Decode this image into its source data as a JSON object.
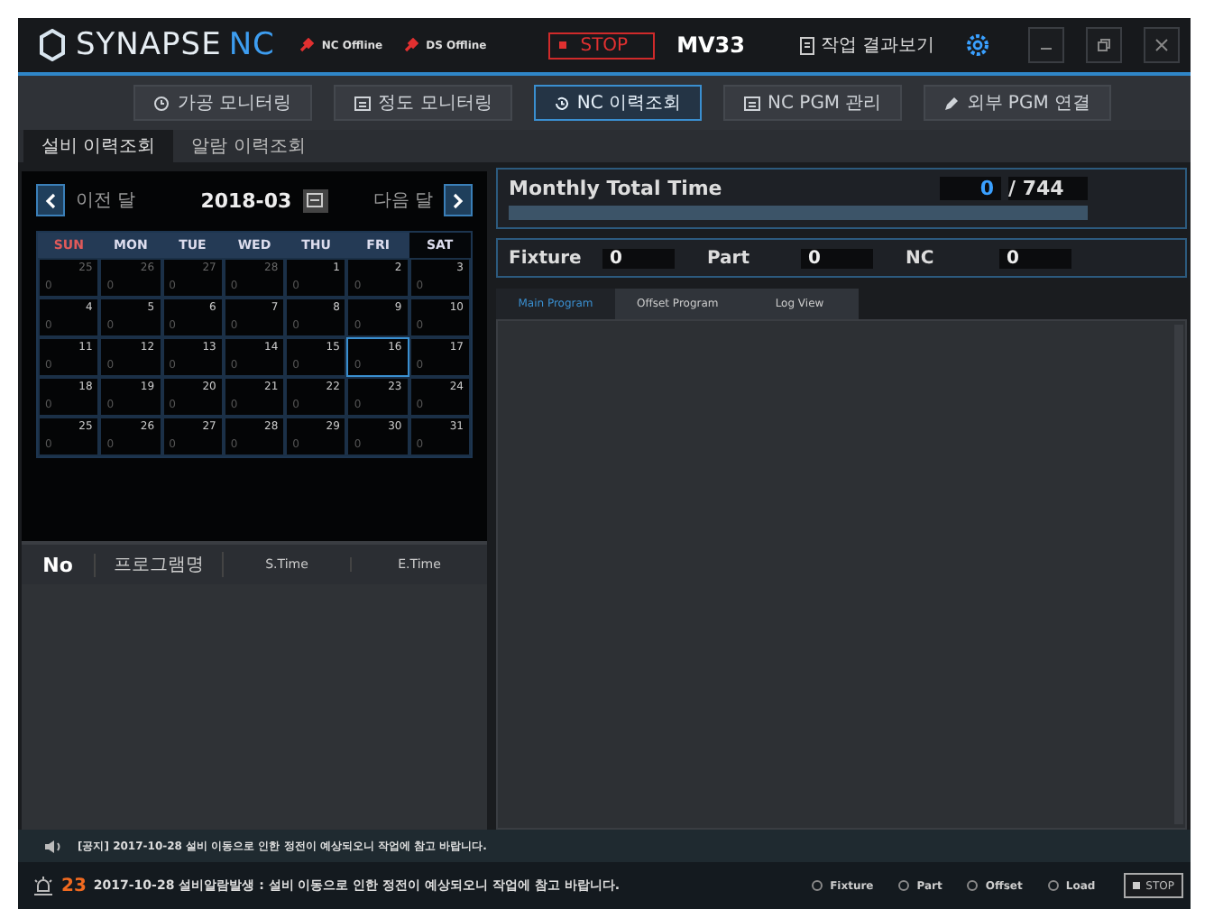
{
  "header": {
    "logo": "SYNAPSE",
    "logo_accent": "NC",
    "connections": [
      {
        "label": "NC Offline"
      },
      {
        "label": "DS Offline"
      }
    ],
    "run_state": "STOP",
    "machine": "MV33",
    "result_button": "작업 결과보기"
  },
  "nav_tabs": [
    {
      "label": "가공 모니터링",
      "selected": false
    },
    {
      "label": "정도 모니터링",
      "selected": false
    },
    {
      "label": "NC 이력조회",
      "selected": true
    },
    {
      "label": "NC PGM 관리",
      "selected": false
    },
    {
      "label": "외부 PGM 연결",
      "selected": false
    }
  ],
  "sub_tabs": [
    {
      "label": "설비 이력조회",
      "selected": true
    },
    {
      "label": "알람 이력조회",
      "selected": false
    }
  ],
  "calendar": {
    "prev": "이전 달",
    "next": "다음 달",
    "month": "2018-03",
    "weekdays": [
      "SUN",
      "MON",
      "TUE",
      "WED",
      "THU",
      "FRI",
      "SAT"
    ],
    "weeks": [
      [
        {
          "day": "25",
          "count": "0",
          "in_month": false,
          "selected": false
        },
        {
          "day": "26",
          "count": "0",
          "in_month": false,
          "selected": false
        },
        {
          "day": "27",
          "count": "0",
          "in_month": false,
          "selected": false
        },
        {
          "day": "28",
          "count": "0",
          "in_month": false,
          "selected": false
        },
        {
          "day": "1",
          "count": "0",
          "in_month": true,
          "selected": false
        },
        {
          "day": "2",
          "count": "0",
          "in_month": true,
          "selected": false
        },
        {
          "day": "3",
          "count": "0",
          "in_month": true,
          "selected": false
        }
      ],
      [
        {
          "day": "4",
          "count": "0",
          "in_month": true,
          "selected": false
        },
        {
          "day": "5",
          "count": "0",
          "in_month": true,
          "selected": false
        },
        {
          "day": "6",
          "count": "0",
          "in_month": true,
          "selected": false
        },
        {
          "day": "7",
          "count": "0",
          "in_month": true,
          "selected": false
        },
        {
          "day": "8",
          "count": "0",
          "in_month": true,
          "selected": false
        },
        {
          "day": "9",
          "count": "0",
          "in_month": true,
          "selected": false
        },
        {
          "day": "10",
          "count": "0",
          "in_month": true,
          "selected": false
        }
      ],
      [
        {
          "day": "11",
          "count": "0",
          "in_month": true,
          "selected": false
        },
        {
          "day": "12",
          "count": "0",
          "in_month": true,
          "selected": false
        },
        {
          "day": "13",
          "count": "0",
          "in_month": true,
          "selected": false
        },
        {
          "day": "14",
          "count": "0",
          "in_month": true,
          "selected": false
        },
        {
          "day": "15",
          "count": "0",
          "in_month": true,
          "selected": false
        },
        {
          "day": "16",
          "count": "0",
          "in_month": true,
          "selected": true
        },
        {
          "day": "17",
          "count": "0",
          "in_month": true,
          "selected": false
        }
      ],
      [
        {
          "day": "18",
          "count": "0",
          "in_month": true,
          "selected": false
        },
        {
          "day": "19",
          "count": "0",
          "in_month": true,
          "selected": false
        },
        {
          "day": "20",
          "count": "0",
          "in_month": true,
          "selected": false
        },
        {
          "day": "21",
          "count": "0",
          "in_month": true,
          "selected": false
        },
        {
          "day": "22",
          "count": "0",
          "in_month": true,
          "selected": false
        },
        {
          "day": "23",
          "count": "0",
          "in_month": true,
          "selected": false
        },
        {
          "day": "24",
          "count": "0",
          "in_month": true,
          "selected": false
        }
      ],
      [
        {
          "day": "25",
          "count": "0",
          "in_month": true,
          "selected": false
        },
        {
          "day": "26",
          "count": "0",
          "in_month": true,
          "selected": false
        },
        {
          "day": "27",
          "count": "0",
          "in_month": true,
          "selected": false
        },
        {
          "day": "28",
          "count": "0",
          "in_month": true,
          "selected": false
        },
        {
          "day": "29",
          "count": "0",
          "in_month": true,
          "selected": false
        },
        {
          "day": "30",
          "count": "0",
          "in_month": true,
          "selected": false
        },
        {
          "day": "31",
          "count": "0",
          "in_month": true,
          "selected": false
        }
      ]
    ]
  },
  "history_table": {
    "columns": [
      "No",
      "프로그램명",
      "S.Time",
      "E.Time"
    ]
  },
  "monthly_total": {
    "label": "Monthly Total Time",
    "value": "0",
    "total": "/ 744",
    "level": 0
  },
  "counters": [
    {
      "label": "Fixture",
      "value": "0"
    },
    {
      "label": "Part",
      "value": "0"
    },
    {
      "label": "NC",
      "value": "0"
    }
  ],
  "program_tabs": [
    {
      "label": "Main Program",
      "selected": true
    },
    {
      "label": "Offset Program",
      "selected": false
    },
    {
      "label": "Log View",
      "selected": false
    }
  ],
  "notice": "[공지] 2017-10-28 설비 이동으로 인한 정전이 예상되오니 작업에 참고 바랍니다.",
  "status_bar": {
    "alarm_count": "23",
    "message": "2017-10-28 설비알람발생 : 설비 이동으로 인한 정전이 예상되오니 작업에 참고 바랍니다.",
    "indicators": [
      {
        "label": "Fixture",
        "on": false
      },
      {
        "label": "Part",
        "on": false
      },
      {
        "label": "Offset",
        "on": false
      },
      {
        "label": "Load",
        "on": false
      }
    ],
    "stop_button": "STOP"
  }
}
